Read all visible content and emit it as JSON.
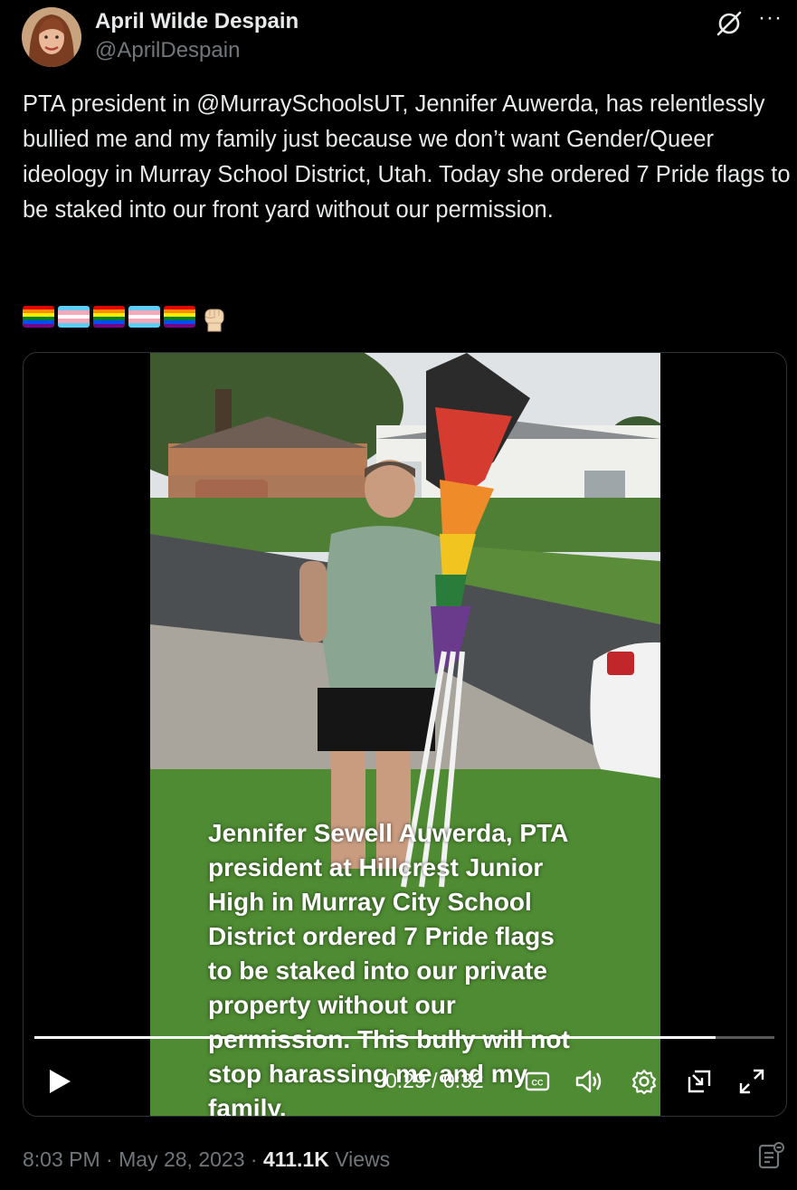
{
  "author": {
    "name": "April Wilde Despain",
    "handle": "@AprilDespain"
  },
  "header_icons": [
    "grok-icon",
    "more-options-icon"
  ],
  "more_label": "···",
  "tweet": {
    "text": "PTA president in @MurraySchoolsUT, Jennifer Auwerda, has relentlessly bullied me and my family just because we don’t want Gender/Queer ideology in Murray School District, Utah. Today she ordered 7 Pride flags to be staked into our front yard without our permission.",
    "emojis": [
      "rainbow-flag",
      "transgender-flag",
      "rainbow-flag",
      "transgender-flag",
      "rainbow-flag",
      "raised-fist"
    ]
  },
  "video": {
    "caption": "Jennifer Sewell Auwerda, PTA\npresident at Hillcrest Junior\nHigh in Murray City School\nDistrict ordered 7 Pride flags\nto be staked into our private\nproperty without our\npermission. This bully will not\nstop harassing me and my\nfamily.",
    "time_display": "0:29 / 0:32",
    "progress": 0.92,
    "controls": [
      "play-icon",
      "captions-icon",
      "volume-icon",
      "settings-icon",
      "pip-icon",
      "fullscreen-icon"
    ]
  },
  "footer": {
    "time": "8:03 PM",
    "date": "May 28, 2023",
    "views_count": "411.1K",
    "views_label": "Views",
    "sep": " · "
  },
  "colors": {
    "background": "#000000",
    "text": "#e7e9ea",
    "muted": "#71767b",
    "border": "#2f3336"
  }
}
